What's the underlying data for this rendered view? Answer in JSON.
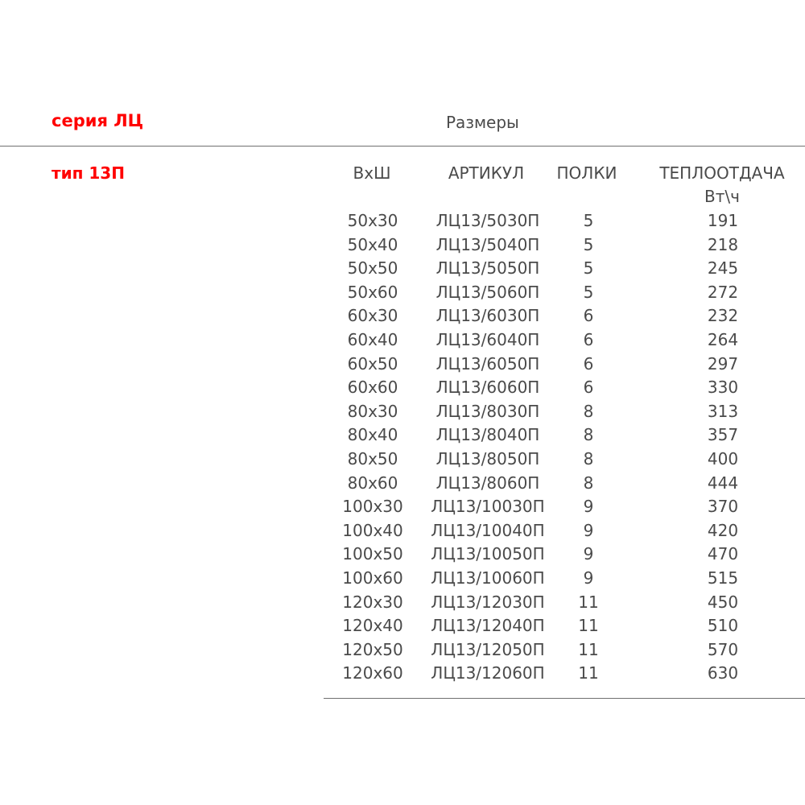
{
  "series_title": "серия ЛЦ",
  "section_header": "Размеры",
  "type_title": "тип 13П",
  "columns": {
    "size": "ВхШ",
    "article": "АРТИКУЛ",
    "shelves": "ПОЛКИ",
    "heat_output": "ТЕПЛООТДАЧА",
    "heat_unit": "Вт\\ч"
  },
  "rows": [
    {
      "size": "50х30",
      "article": "ЛЦ13/5030П",
      "shelves": "5",
      "heat": "191"
    },
    {
      "size": "50х40",
      "article": "ЛЦ13/5040П",
      "shelves": "5",
      "heat": "218"
    },
    {
      "size": "50х50",
      "article": "ЛЦ13/5050П",
      "shelves": "5",
      "heat": "245"
    },
    {
      "size": "50х60",
      "article": "ЛЦ13/5060П",
      "shelves": "5",
      "heat": "272"
    },
    {
      "size": "60х30",
      "article": "ЛЦ13/6030П",
      "shelves": "6",
      "heat": "232"
    },
    {
      "size": "60х40",
      "article": "ЛЦ13/6040П",
      "shelves": "6",
      "heat": "264"
    },
    {
      "size": "60х50",
      "article": "ЛЦ13/6050П",
      "shelves": "6",
      "heat": "297"
    },
    {
      "size": "60х60",
      "article": "ЛЦ13/6060П",
      "shelves": "6",
      "heat": "330"
    },
    {
      "size": "80х30",
      "article": "ЛЦ13/8030П",
      "shelves": "8",
      "heat": "313"
    },
    {
      "size": "80х40",
      "article": "ЛЦ13/8040П",
      "shelves": "8",
      "heat": "357"
    },
    {
      "size": "80х50",
      "article": "ЛЦ13/8050П",
      "shelves": "8",
      "heat": "400"
    },
    {
      "size": "80х60",
      "article": "ЛЦ13/8060П",
      "shelves": "8",
      "heat": "444"
    },
    {
      "size": "100х30",
      "article": "ЛЦ13/10030П",
      "shelves": "9",
      "heat": "370"
    },
    {
      "size": "100х40",
      "article": "ЛЦ13/10040П",
      "shelves": "9",
      "heat": "420"
    },
    {
      "size": "100х50",
      "article": "ЛЦ13/10050П",
      "shelves": "9",
      "heat": "470"
    },
    {
      "size": "100х60",
      "article": "ЛЦ13/10060П",
      "shelves": "9",
      "heat": "515"
    },
    {
      "size": "120х30",
      "article": "ЛЦ13/12030П",
      "shelves": "11",
      "heat": "450"
    },
    {
      "size": "120х40",
      "article": "ЛЦ13/12040П",
      "shelves": "11",
      "heat": "510"
    },
    {
      "size": "120х50",
      "article": "ЛЦ13/12050П",
      "shelves": "11",
      "heat": "570"
    },
    {
      "size": "120х60",
      "article": "ЛЦ13/12060П",
      "shelves": "11",
      "heat": "630"
    }
  ],
  "colors": {
    "accent": "#ff0000",
    "text": "#4a4a4a",
    "divider": "#707070"
  }
}
